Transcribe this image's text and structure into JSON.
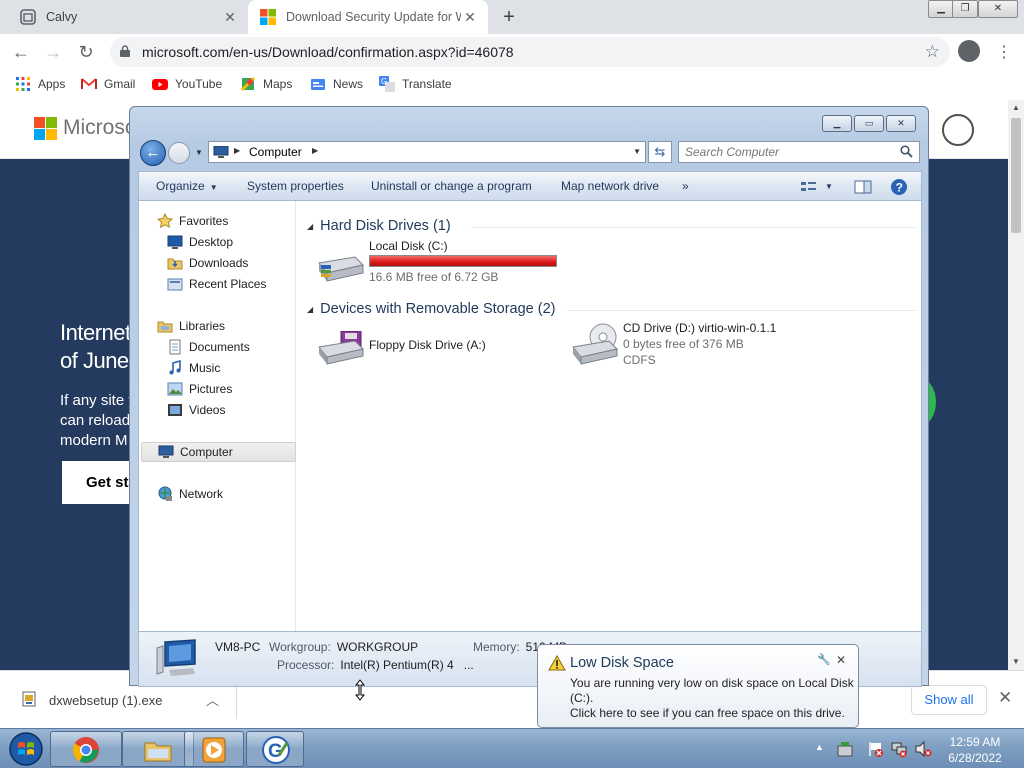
{
  "browser": {
    "tabs": [
      {
        "label": "Calvy"
      },
      {
        "label": "Download Security Update for Win"
      }
    ],
    "url": "microsoft.com/en-us/Download/confirmation.aspx?id=46078",
    "bookmarks": [
      {
        "label": "Apps"
      },
      {
        "label": "Gmail"
      },
      {
        "label": "YouTube"
      },
      {
        "label": "Maps"
      },
      {
        "label": "News"
      },
      {
        "label": "Translate"
      }
    ]
  },
  "page": {
    "brand": "Microsoft",
    "hero_title_1": "Internet",
    "hero_title_2": "of June",
    "hero_body_1": "If any site y",
    "hero_body_2": "can reload",
    "hero_body_3": "modern M",
    "cta": "Get started"
  },
  "download_bar": {
    "filename": "dxwebsetup (1).exe",
    "show_all": "Show all"
  },
  "explorer": {
    "breadcrumb": "Computer",
    "search_placeholder": "Search Computer",
    "commands": {
      "organize": "Organize",
      "system_properties": "System properties",
      "uninstall": "Uninstall or change a program",
      "map_drive": "Map network drive",
      "more": "»"
    },
    "nav": {
      "favorites": "Favorites",
      "desktop": "Desktop",
      "downloads": "Downloads",
      "recent": "Recent Places",
      "libraries": "Libraries",
      "documents": "Documents",
      "music": "Music",
      "pictures": "Pictures",
      "videos": "Videos",
      "computer": "Computer",
      "network": "Network"
    },
    "groups": {
      "hdd": "Hard Disk Drives (1)",
      "removable": "Devices with Removable Storage (2)"
    },
    "drives": {
      "c_name": "Local Disk (C:)",
      "c_free": "16.6 MB free of 6.72 GB",
      "c_used_fraction": 0.998,
      "a_name": "Floppy Disk Drive (A:)",
      "d_name": "CD Drive (D:) virtio-win-0.1.1",
      "d_free": "0 bytes free of 376 MB",
      "d_fs": "CDFS"
    },
    "details": {
      "pc_name": "VM8-PC",
      "workgroup_label": "Workgroup:",
      "workgroup": "WORKGROUP",
      "memory_label": "Memory:",
      "memory": "512 MB",
      "processor_label": "Processor:",
      "processor": "Intel(R) Pentium(R) 4",
      "ellipsis": "..."
    }
  },
  "balloon": {
    "title": "Low Disk Space",
    "line1": "You are running very low on disk space on Local Disk",
    "line2": "(C:).",
    "line3": "Click here to see if you can free space on this drive."
  },
  "taskbar": {
    "time": "12:59 AM",
    "date": "6/28/2022"
  }
}
